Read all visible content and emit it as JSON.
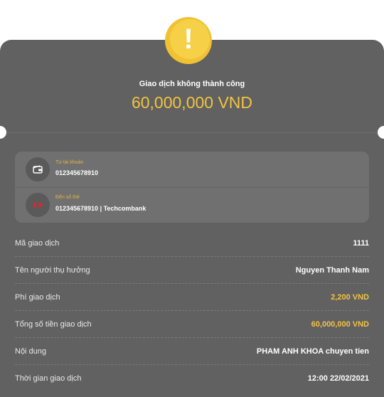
{
  "header": {
    "status_icon": "exclamation-icon",
    "status_title": "Giao dịch không thành công",
    "amount": "60,000,000 VND"
  },
  "accounts": {
    "from": {
      "icon": "wallet-icon",
      "label": "Từ tài khoản",
      "value": "012345678910"
    },
    "to": {
      "icon": "techcombank-logo-icon",
      "label": "Đến số thẻ",
      "value": "012345678910 | Techcombank"
    }
  },
  "details": [
    {
      "label": "Mã giao dịch",
      "value": "1111"
    },
    {
      "label": "Tên người thụ hưởng",
      "value": "Nguyen Thanh Nam"
    },
    {
      "label": "Phí giao dịch",
      "value": "2,200 VND"
    },
    {
      "label": "Tổng số tiền giao dịch",
      "value": "60,000,000 VND"
    },
    {
      "label": "Nội dung",
      "value": "PHAM ANH KHOA chuyen tien"
    },
    {
      "label": "Thời gian giao dịch",
      "value": "12:00 22/02/2021"
    }
  ],
  "colors": {
    "card_bg": "#616161",
    "accent": "#f3c340",
    "warning": "#f0c233",
    "bank_red": "#e8232b"
  }
}
